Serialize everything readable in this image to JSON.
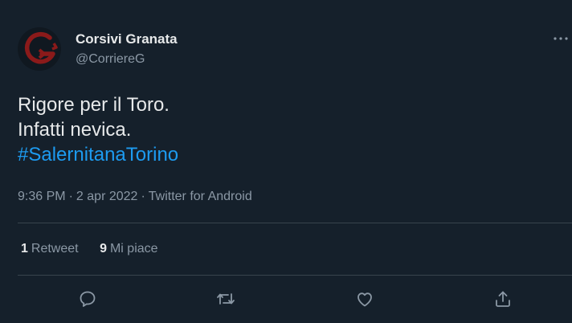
{
  "author": {
    "display_name": "Corsivi Granata",
    "handle": "@CorriereG",
    "avatar_icon": "red-g-logo-icon",
    "avatar_color": "#8b1a1a"
  },
  "tweet": {
    "lines": [
      "Rigore per il Toro.",
      "Infatti nevica."
    ],
    "hashtag": "#SalernitanaTorino",
    "time": "9:36 PM",
    "date": "2 apr 2022",
    "separator": "·",
    "source": "Twitter for Android"
  },
  "stats": {
    "retweets_count": "1",
    "retweets_label": "Retweet",
    "likes_count": "9",
    "likes_label": "Mi piace"
  },
  "actions": {
    "reply_icon": "reply-icon",
    "retweet_icon": "retweet-icon",
    "like_icon": "heart-icon",
    "share_icon": "share-icon",
    "more_icon": "more-icon"
  },
  "colors": {
    "background": "#15202b",
    "accent": "#1d9bf0",
    "text_secondary": "#8b98a5",
    "divider": "#38444d"
  }
}
